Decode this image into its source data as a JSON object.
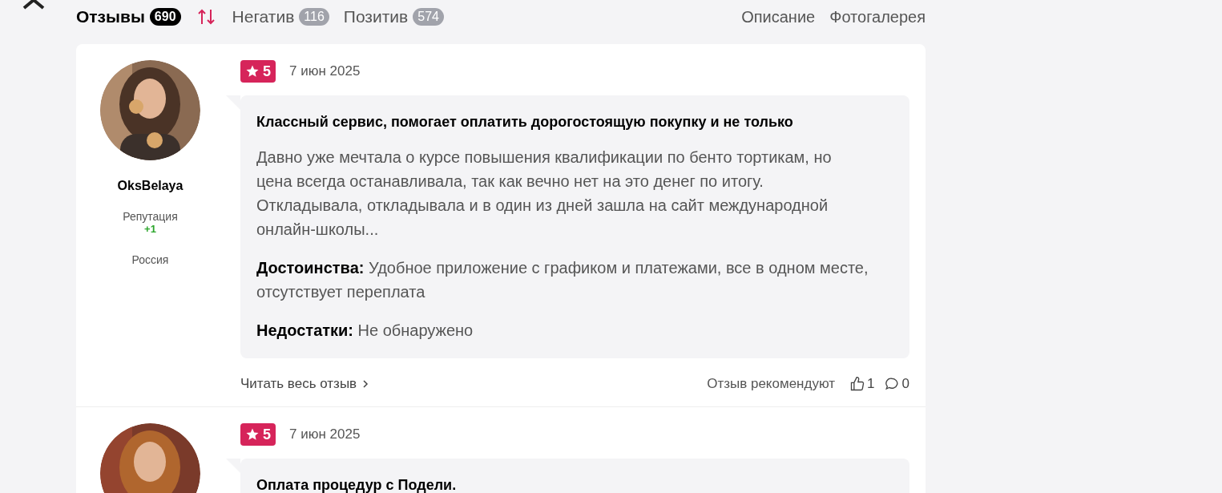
{
  "tabs": [
    {
      "label": "Отзывы",
      "count": "690",
      "selected": true
    },
    {
      "label": "Негатив",
      "count": "116",
      "selected": false
    },
    {
      "label": "Позитив",
      "count": "574",
      "selected": false
    }
  ],
  "links": [
    "Описание",
    "Фотогалерея"
  ],
  "reviews": [
    {
      "author": "OksBelaya",
      "reputation_label": "Репутация",
      "reputation": "+1",
      "country": "Россия",
      "rating": "5",
      "date": "7 июн 2025",
      "title": "Классный сервис, помогает оплатить дорогостоящую покупку и не только",
      "text": "Давно уже мечтала о курсе повышения квалификации по бенто тортикам, но цена всегда останавливала, так как вечно нет на это денег по итогу. Откладывала, откладывала и в один из дней зашла на сайт международной онлайн-школы...",
      "pros_label": "Достоинства:",
      "pros": "Удобное приложение с графиком и платежами, все в одном месте, отсутствует переплата",
      "cons_label": "Недостатки:",
      "cons": "Не обнаружено",
      "read_more": "Читать весь отзыв",
      "recommend_label": "Отзыв рекомендуют",
      "likes": "1",
      "comments": "0"
    },
    {
      "rating": "5",
      "date": "7 июн 2025",
      "title": "Оплата процедур с Подели."
    }
  ]
}
